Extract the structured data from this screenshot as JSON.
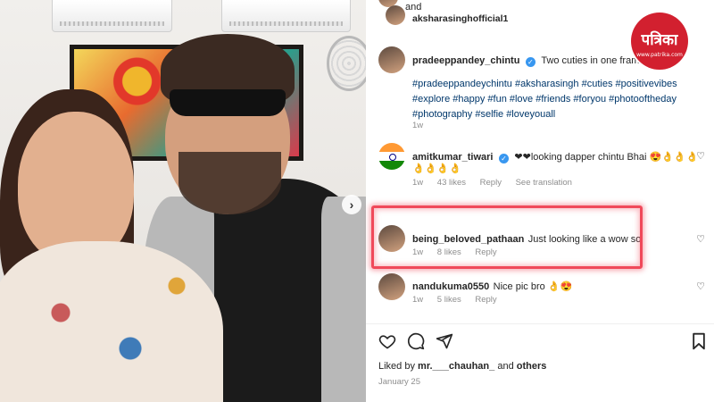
{
  "header": {
    "and_text": "and",
    "collaborator": "aksharasinghofficial1"
  },
  "caption": {
    "username": "pradeeppandey_chintu",
    "text": "Two cuties in one frame",
    "hashtags": "#pradeeppandeychintu #aksharasingh #cuties #positivevibes #explore #happy #fun #love #friends #foryou #photooftheday #photography #selfie #loveyouall",
    "time": "1w"
  },
  "comments": [
    {
      "username": "amitkumar_tiwari",
      "verified": true,
      "text": "❤❤looking dapper chintu Bhai 😍👌👌👌",
      "extra_line": "👌👌👌👌",
      "time": "1w",
      "likes": "43 likes",
      "reply": "Reply",
      "translation": "See translation"
    },
    {
      "username": "being_beloved_pathaan",
      "text": "Just looking like a wow so",
      "time": "1w",
      "likes": "8 likes",
      "reply": "Reply"
    },
    {
      "username": "nandukuma0550",
      "text": "Nice pic bro 👌😍",
      "time": "1w",
      "likes": "5 likes",
      "reply": "Reply"
    }
  ],
  "footer": {
    "liked_by_prefix": "Liked by",
    "liked_by_user": "mr.___chauhan_",
    "liked_by_and": "and",
    "liked_by_others": "others",
    "date": "January 25"
  },
  "logo": {
    "main": "पत्रिका",
    "sub": "www.patrika.com"
  },
  "photo": {
    "carousel_arrow": "›"
  },
  "colors": {
    "highlight": "#f0495a",
    "link": "#00376b",
    "logo_red": "#d2202f",
    "verified_blue": "#3897f0"
  }
}
